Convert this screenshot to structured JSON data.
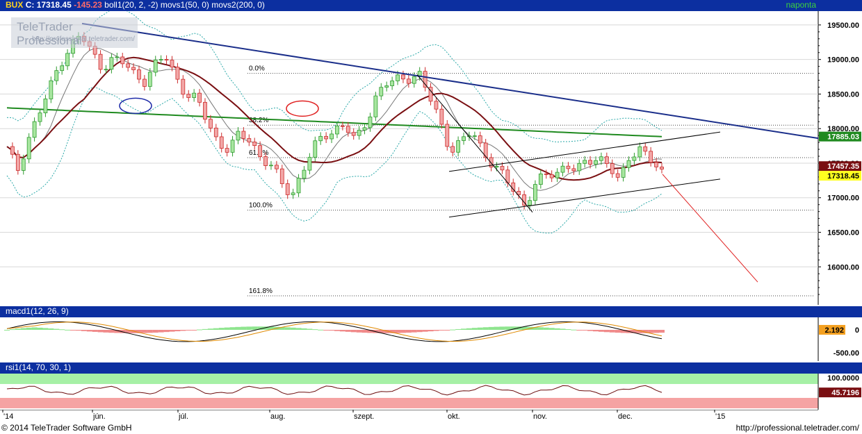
{
  "header": {
    "instrument": "BUX",
    "close_label": "C:",
    "close_value": "17318.45",
    "change": "-145.23",
    "indicators": "boll1(20, 2, -2) movs1(50, 0) movs2(200, 0)",
    "period": "naponta"
  },
  "watermark": {
    "title": "TeleTrader Professional",
    "url": "http://professional.teletrader.com/"
  },
  "macd_panel": {
    "label": "macd1(12, 26, 9)",
    "value_tag": "2.192"
  },
  "rsi_panel": {
    "label": "rsi1(14, 70, 30, 1)",
    "value_tag": "45.7196"
  },
  "footer": {
    "copyright": "© 2014 TeleTrader Software GmbH",
    "url": "http://professional.teletrader.com/"
  },
  "colors": {
    "header_bg": "#0c2fa0",
    "ma50": "#7a0f12",
    "ma200": "#1f8a1f",
    "trend": "#1a2e8a",
    "bollinger": "#2aa8a8",
    "up": "#2e9b2e",
    "down": "#cc2a2a"
  },
  "chart_data": [
    {
      "type": "candlestick",
      "panel": "price",
      "y_axis_ticks": [
        "19500.00",
        "19000.00",
        "18500.00",
        "18000.00",
        "17500.00",
        "17000.00",
        "16500.00",
        "16000.00"
      ],
      "ylim": [
        15450,
        19700
      ],
      "x_axis_labels": [
        "'14",
        "jún.",
        "júl.",
        "aug.",
        "szept.",
        "okt.",
        "nov.",
        "dec.",
        "'15"
      ],
      "last_values": {
        "ma200": "17885.03",
        "ma50": "17457.35",
        "close": "17318.45"
      },
      "fibonacci_labels": [
        "0.0%",
        "38.2%",
        "61.8%",
        "100.0%",
        "161.8%"
      ],
      "fibonacci_levels": [
        18800,
        18050,
        17580,
        16820,
        15580
      ],
      "close_series_approx": [
        17700,
        17400,
        17850,
        18200,
        18550,
        18950,
        19200,
        19350,
        19100,
        18900,
        19000,
        18950,
        18800,
        18700,
        18900,
        19050,
        18750,
        18500,
        18400,
        18100,
        17800,
        17700,
        17900,
        17850,
        17600,
        17450,
        17200,
        17050,
        17400,
        17700,
        17900,
        18000,
        18050,
        17800,
        18100,
        18500,
        18650,
        18700,
        18750,
        18800,
        18450,
        18100,
        17700,
        17800,
        17950,
        17700,
        17500,
        17300,
        17100,
        16900,
        17200,
        17300,
        17350,
        17500,
        17400,
        17500,
        17600,
        17500,
        17200,
        17600,
        17750,
        17550,
        17318
      ]
    },
    {
      "type": "line",
      "panel": "macd",
      "series": [
        "macd",
        "signal",
        "histogram"
      ],
      "y_axis_ticks": [
        "0",
        "-500.00"
      ],
      "last_value": "2.192"
    },
    {
      "type": "line",
      "panel": "rsi",
      "series": [
        "rsi"
      ],
      "y_axis_ticks": [
        "100.0000"
      ],
      "last_value": "45.7196",
      "bands": [
        70,
        30
      ]
    }
  ]
}
